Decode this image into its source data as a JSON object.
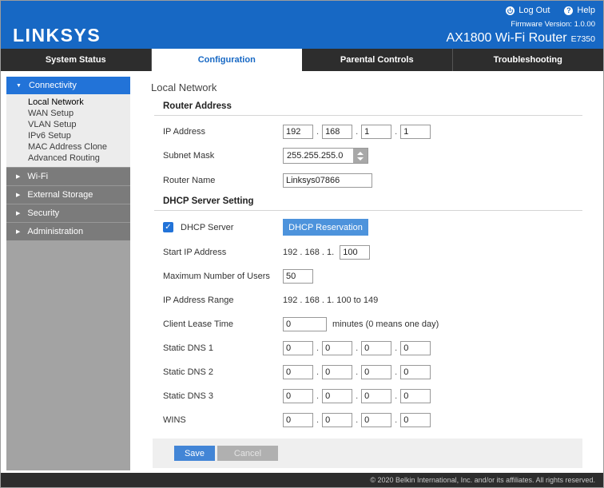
{
  "colors": {
    "brand_blue": "#1768C4",
    "sidebar_active_blue": "#2273D8",
    "button_blue": "#4D93DC",
    "save_blue": "#4285D6",
    "nav_dark": "#2D2D2D"
  },
  "ui": {
    "dot": ".",
    "check": "✓",
    "arrow_expanded": "▼",
    "arrow_collapsed": "▶",
    "help_glyph": "?"
  },
  "header": {
    "logo": "LINKSYS",
    "logout_label": "Log Out",
    "help_label": "Help",
    "firmware": "Firmware Version: 1.0.00",
    "router_title": "AX1800 Wi-Fi Router",
    "router_model": "E7350"
  },
  "tabs": [
    {
      "label": "System Status"
    },
    {
      "label": "Configuration"
    },
    {
      "label": "Parental Controls"
    },
    {
      "label": "Troubleshooting"
    }
  ],
  "sidebar": {
    "active_group": "Connectivity",
    "subitems": [
      "Local Network",
      "WAN Setup",
      "VLAN Setup",
      "IPv6 Setup",
      "MAC Address Clone",
      "Advanced Routing"
    ],
    "groups": [
      "Wi-Fi",
      "External Storage",
      "Security",
      "Administration"
    ]
  },
  "main": {
    "title": "Local Network",
    "router_address": {
      "heading": "Router Address",
      "ip_label": "IP Address",
      "ip_octets": [
        "192",
        "168",
        "1",
        "1"
      ],
      "subnet_label": "Subnet Mask",
      "subnet_value": "255.255.255.0",
      "router_name_label": "Router Name",
      "router_name_value": "Linksys07866"
    },
    "dhcp": {
      "heading": "DHCP Server Setting",
      "server_label": "DHCP Server",
      "reservation_button": "DHCP Reservation",
      "start_ip_label": "Start IP Address",
      "start_ip_prefix": "192 . 168 . 1.",
      "start_ip_value": "100",
      "max_users_label": "Maximum Number of  Users",
      "max_users_value": "50",
      "range_label": "IP Address Range",
      "range_value": "192 . 168 . 1. 100 to 149",
      "lease_label": "Client Lease Time",
      "lease_value": "0",
      "lease_suffix": "minutes (0 means one day)",
      "dns1_label": "Static DNS 1",
      "dns1_octets": [
        "0",
        "0",
        "0",
        "0"
      ],
      "dns2_label": "Static DNS 2",
      "dns2_octets": [
        "0",
        "0",
        "0",
        "0"
      ],
      "dns3_label": "Static DNS 3",
      "dns3_octets": [
        "0",
        "0",
        "0",
        "0"
      ],
      "wins_label": "WINS",
      "wins_octets": [
        "0",
        "0",
        "0",
        "0"
      ]
    },
    "actions": {
      "save": "Save",
      "cancel": "Cancel"
    }
  },
  "footer": {
    "copyright": "© 2020 Belkin International, Inc. and/or its affiliates. All rights reserved."
  }
}
